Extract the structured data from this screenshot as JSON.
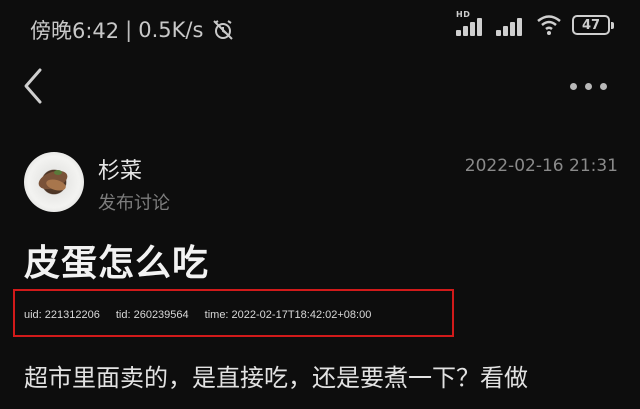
{
  "status_bar": {
    "time": "傍晚6:42",
    "separator": "|",
    "net_speed": "0.5K/s",
    "network_label": "HD",
    "battery_level": "47",
    "icons": [
      "alarm-off-icon",
      "signal-hd-icon",
      "signal-icon",
      "wifi-icon",
      "battery-icon"
    ]
  },
  "nav": {
    "back_icon": "chevron-left-icon",
    "more_icon": "more-horizontal-icon"
  },
  "post": {
    "author": "杉菜",
    "action": "发布讨论",
    "date": "2022-02-16 21:31",
    "title": "皮蛋怎么吃",
    "meta": {
      "uid": "uid: 221312206",
      "tid": "tid: 260239564",
      "time": "time: 2022-02-17T18:42:02+08:00"
    },
    "body": "超市里面卖的，是直接吃，还是要煮一下？看做"
  },
  "colors": {
    "background": "#0d0d0d",
    "highlight_border": "#d11a1a",
    "text_primary": "#f2f2f2",
    "text_secondary": "#7d7d7d"
  }
}
